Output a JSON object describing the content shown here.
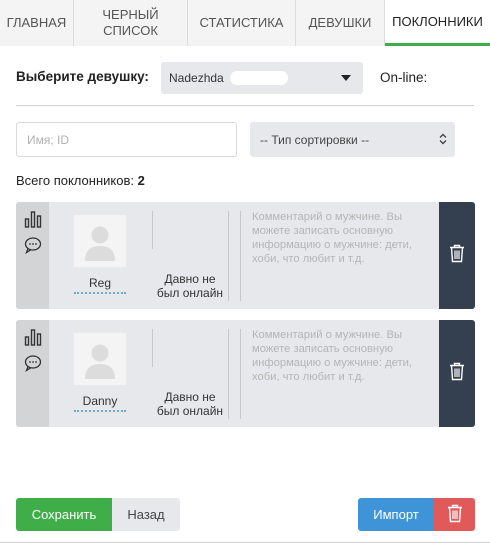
{
  "tabs": [
    {
      "label": "ГЛАВНАЯ",
      "active": false
    },
    {
      "label": "ЧЕРНЫЙ\nСПИСОК",
      "active": false
    },
    {
      "label": "СТАТИСТИКА",
      "active": false
    },
    {
      "label": "ДЕВУШКИ",
      "active": false
    },
    {
      "label": "ПОКЛОННИКИ",
      "active": true
    }
  ],
  "girl_select": {
    "label": "Выберите девушку:",
    "value": "Nadezhda"
  },
  "online_label": "On-line:",
  "search": {
    "placeholder": "Имя; ID"
  },
  "sort": {
    "value": "-- Тип сортировки --"
  },
  "total": {
    "label": "Всего поклонников:",
    "count": "2"
  },
  "fans": [
    {
      "name": "Reg",
      "status": "Давно не был онлайн",
      "comment_placeholder": "Комментарий о мужчине. Вы можете записать основную информацию о мужчине: дети, хоби, что любит и т.д."
    },
    {
      "name": "Danny",
      "status": "Давно не был онлайн",
      "comment_placeholder": "Комментарий о мужчине. Вы можете записать основную информацию о мужчине: дети, хоби, что любит и т.д."
    }
  ],
  "buttons": {
    "save": "Сохранить",
    "back": "Назад",
    "import": "Импорт"
  },
  "colors": {
    "accent_green": "#3fae49",
    "import_blue": "#3e94d6",
    "delete_red": "#e05a59",
    "card_dark": "#344050"
  },
  "icons": {
    "stats": "bar-chart-icon",
    "chat": "chat-bubble-icon",
    "delete": "trash-icon",
    "avatar": "user-placeholder-icon"
  }
}
